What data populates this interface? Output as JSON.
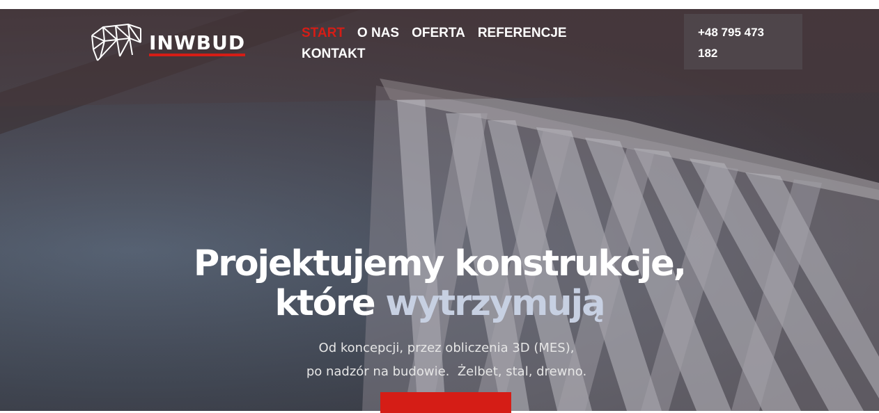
{
  "brand": {
    "name": "INWBUD"
  },
  "nav": {
    "items": [
      {
        "label": "START",
        "active": true
      },
      {
        "label": "O NAS",
        "active": false
      },
      {
        "label": "OFERTA",
        "active": false
      },
      {
        "label": "REFERENCJE",
        "active": false
      },
      {
        "label": "KONTAKT",
        "active": false
      }
    ]
  },
  "contact": {
    "phone_line1": "+48 795 473",
    "phone_line2": "182"
  },
  "hero": {
    "title_line1": "Projektujemy konstrukcje,",
    "title_line2_plain": "które",
    "title_line2_accent": "wytrzymują",
    "subtitle_line1": "Od koncepcji, przez obliczenia 3D (MES),",
    "subtitle_line2": "po nadzór na budowie.  Żelbet, stal, drewno.",
    "cta_label": ""
  },
  "colors": {
    "accent": "#d51d16",
    "headline_accent": "#c7d0e2",
    "text": "#ffffff"
  },
  "icons": {
    "logo": "truss-structure-icon"
  }
}
